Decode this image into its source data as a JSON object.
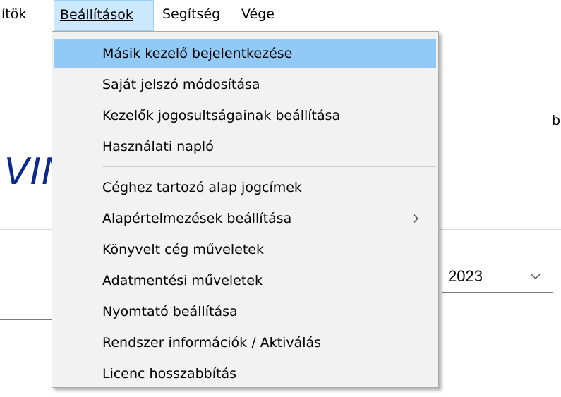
{
  "menubar": {
    "items": [
      {
        "label": "ítök",
        "active": false
      },
      {
        "label": "Beállítások",
        "active": true
      },
      {
        "label": "Segítség",
        "active": false
      },
      {
        "label": "Vége",
        "active": false
      }
    ]
  },
  "background": {
    "title_fragment": "VIN",
    "right_fragment": "b",
    "year_combo": {
      "value": "2023"
    }
  },
  "dropdown": {
    "items": [
      {
        "label": "Másik kezelő bejelentkezése",
        "highlighted": true
      },
      {
        "label": "Saját jelszó módosítása"
      },
      {
        "label": "Kezelők jogosultságainak beállítása"
      },
      {
        "label": "Használati napló"
      },
      {
        "label": "Céghez tartozó alap jogcímek"
      },
      {
        "label": "Alapértelmezések beállítása",
        "submenu": true
      },
      {
        "label": "Könyvelt cég műveletek"
      },
      {
        "label": "Adatmentési műveletek"
      },
      {
        "label": "Nyomtató beállítása"
      },
      {
        "label": "Rendszer információk / Aktiválás"
      },
      {
        "label": "Licenc hosszabbítás"
      }
    ]
  },
  "colors": {
    "highlight": "#91c9f7",
    "menu_bg": "#f2f2f2",
    "title_blue": "#0b2a8a",
    "active_menubar": "#cce8ff"
  }
}
